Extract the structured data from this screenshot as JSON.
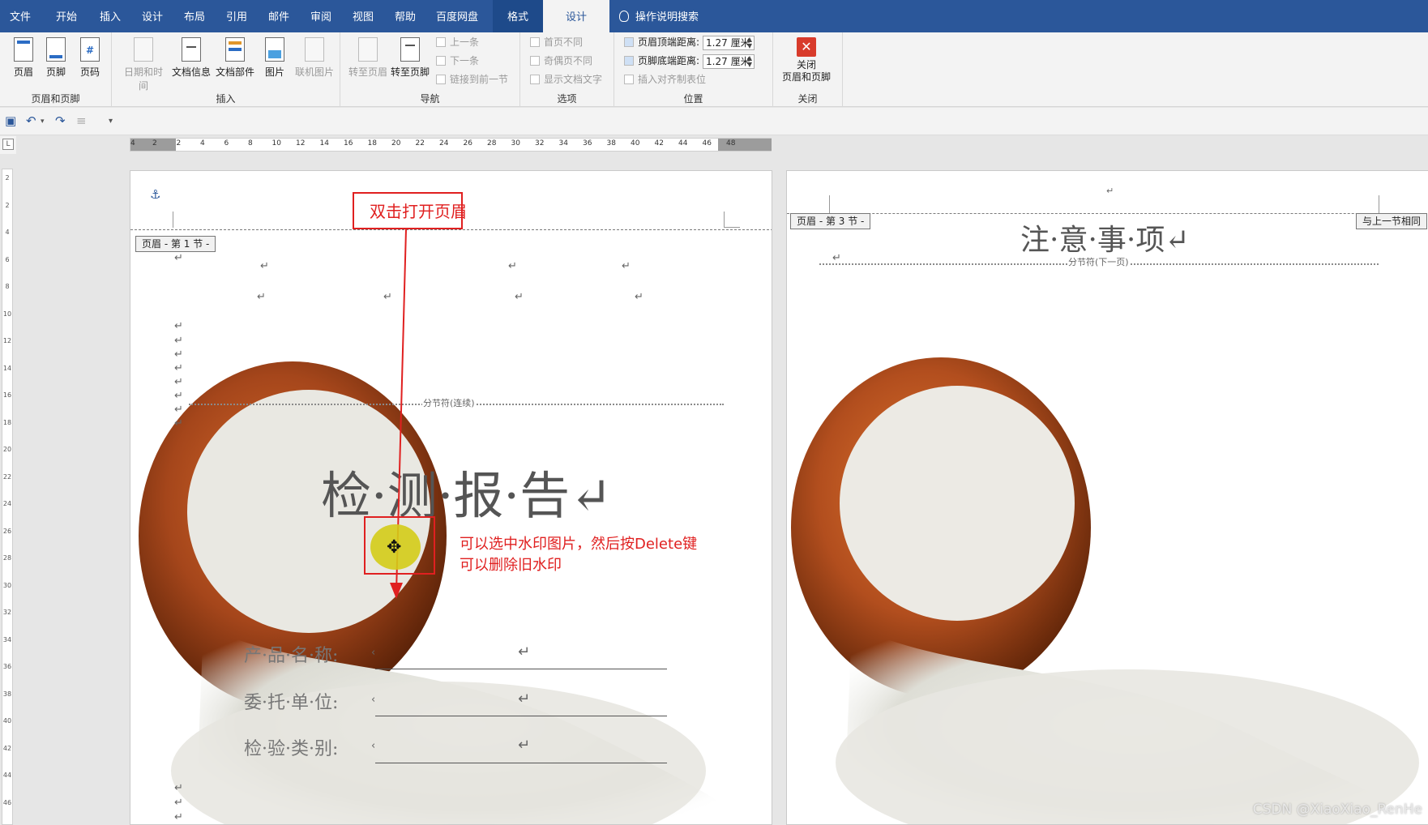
{
  "tabs": [
    "文件",
    "开始",
    "插入",
    "设计",
    "布局",
    "引用",
    "邮件",
    "审阅",
    "视图",
    "帮助",
    "百度网盘",
    "格式",
    "设计",
    "操作说明搜索"
  ],
  "ribbon": {
    "groups": {
      "header_footer": {
        "label": "页眉和页脚",
        "buttons": [
          "页眉",
          "页脚",
          "页码"
        ]
      },
      "insert": {
        "label": "插入",
        "buttons": [
          "日期和时间",
          "文档信息",
          "文档部件",
          "图片",
          "联机图片"
        ]
      },
      "navigation": {
        "label": "导航",
        "buttons": [
          "转至页眉",
          "转至页脚"
        ],
        "small": [
          "上一条",
          "下一条",
          "链接到前一节"
        ]
      },
      "options": {
        "label": "选项",
        "checks": [
          "首页不同",
          "奇偶页不同",
          "显示文档文字"
        ]
      },
      "position": {
        "label": "位置",
        "header_top_label": "页眉顶端距离:",
        "header_top_value": "1.27 厘米",
        "footer_bottom_label": "页脚底端距离:",
        "footer_bottom_value": "1.27 厘米",
        "align_tab": "插入对齐制表位"
      },
      "close": {
        "label": "关闭",
        "button": "关闭\n页眉和页脚"
      }
    }
  },
  "ruler": {
    "h_numbers": [
      "4",
      "2",
      "2",
      "4",
      "6",
      "8",
      "10",
      "12",
      "14",
      "16",
      "18",
      "20",
      "22",
      "24",
      "26",
      "28",
      "30",
      "32",
      "34",
      "36",
      "38",
      "40",
      "42",
      "44",
      "46",
      "48"
    ],
    "v_numbers": [
      "2",
      "2",
      "4",
      "6",
      "8",
      "10",
      "12",
      "14",
      "16",
      "18",
      "20",
      "22",
      "24",
      "26",
      "28",
      "30",
      "32",
      "34",
      "36",
      "38",
      "40",
      "42",
      "44",
      "46"
    ]
  },
  "page1": {
    "header_tag": "页眉 - 第 1 节 -",
    "section_break": "分节符(连续)",
    "title": "检·测·报·告↵",
    "fields": [
      "产·品·名·称:",
      "委·托·单·位:",
      "检·验·类·别:"
    ],
    "para_mark": "↵",
    "anchor": "⚓"
  },
  "page2": {
    "header_tag": "页眉 - 第 3 节 -",
    "same_as_prev": "与上一节相同",
    "title": "注·意·事·项↵",
    "section_break": "分节符(下一页)",
    "para_mark": "↵"
  },
  "annotations": {
    "box_label": "双击打开页眉",
    "note_line1": "可以选中水印图片，然后按Delete键",
    "note_line2": "可以删除旧水印",
    "accent": "#e02020"
  },
  "credit": "CSDN @XiaoXiao_RenHe"
}
